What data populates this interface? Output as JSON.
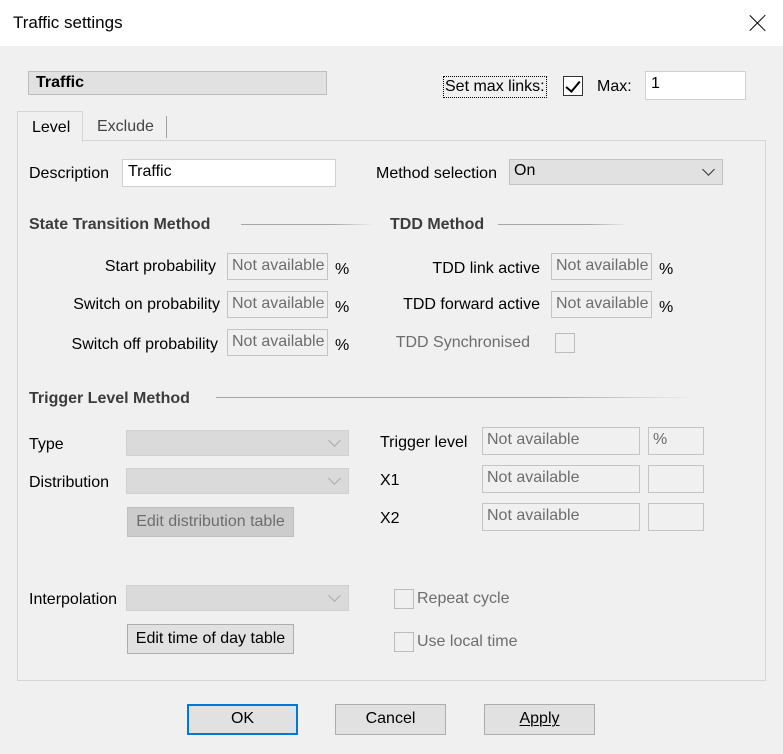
{
  "window": {
    "title": "Traffic settings"
  },
  "header": {
    "group_title": "Traffic",
    "set_max_links_label": "Set max links:",
    "set_max_links_checked": true,
    "max_label": "Max:",
    "max_value": "1"
  },
  "tabs": [
    {
      "label": "Level",
      "active": true
    },
    {
      "label": "Exclude",
      "active": false
    }
  ],
  "level": {
    "description_label": "Description",
    "description_value": "Traffic",
    "method_selection_label": "Method selection",
    "method_selection_value": "On",
    "state_transition": {
      "title": "State Transition Method",
      "start_label": "Start probability",
      "start_value": "Not available",
      "switch_on_label": "Switch on probability",
      "switch_on_value": "Not available",
      "switch_off_label": "Switch off probability",
      "switch_off_value": "Not available",
      "unit": "%"
    },
    "tdd": {
      "title": "TDD Method",
      "link_active_label": "TDD link active",
      "link_active_value": "Not available",
      "forward_active_label": "TDD forward active",
      "forward_active_value": "Not available",
      "synchronised_label": "TDD Synchronised",
      "unit": "%"
    },
    "trigger": {
      "title": "Trigger Level Method",
      "type_label": "Type",
      "distribution_label": "Distribution",
      "edit_distribution_label": "Edit distribution table",
      "trigger_level_label": "Trigger level",
      "trigger_level_value": "Not available",
      "trigger_level_unit": "%",
      "x1_label": "X1",
      "x1_value": "Not available",
      "x2_label": "X2",
      "x2_value": "Not available"
    },
    "interpolation_label": "Interpolation",
    "edit_time_of_day_label": "Edit time of day table",
    "repeat_cycle_label": "Repeat cycle",
    "use_local_time_label": "Use local time"
  },
  "buttons": {
    "ok": "OK",
    "cancel": "Cancel",
    "apply": "Apply"
  },
  "colors": {
    "accent": "#0078d7",
    "disabled_text": "#6d6d6d"
  }
}
